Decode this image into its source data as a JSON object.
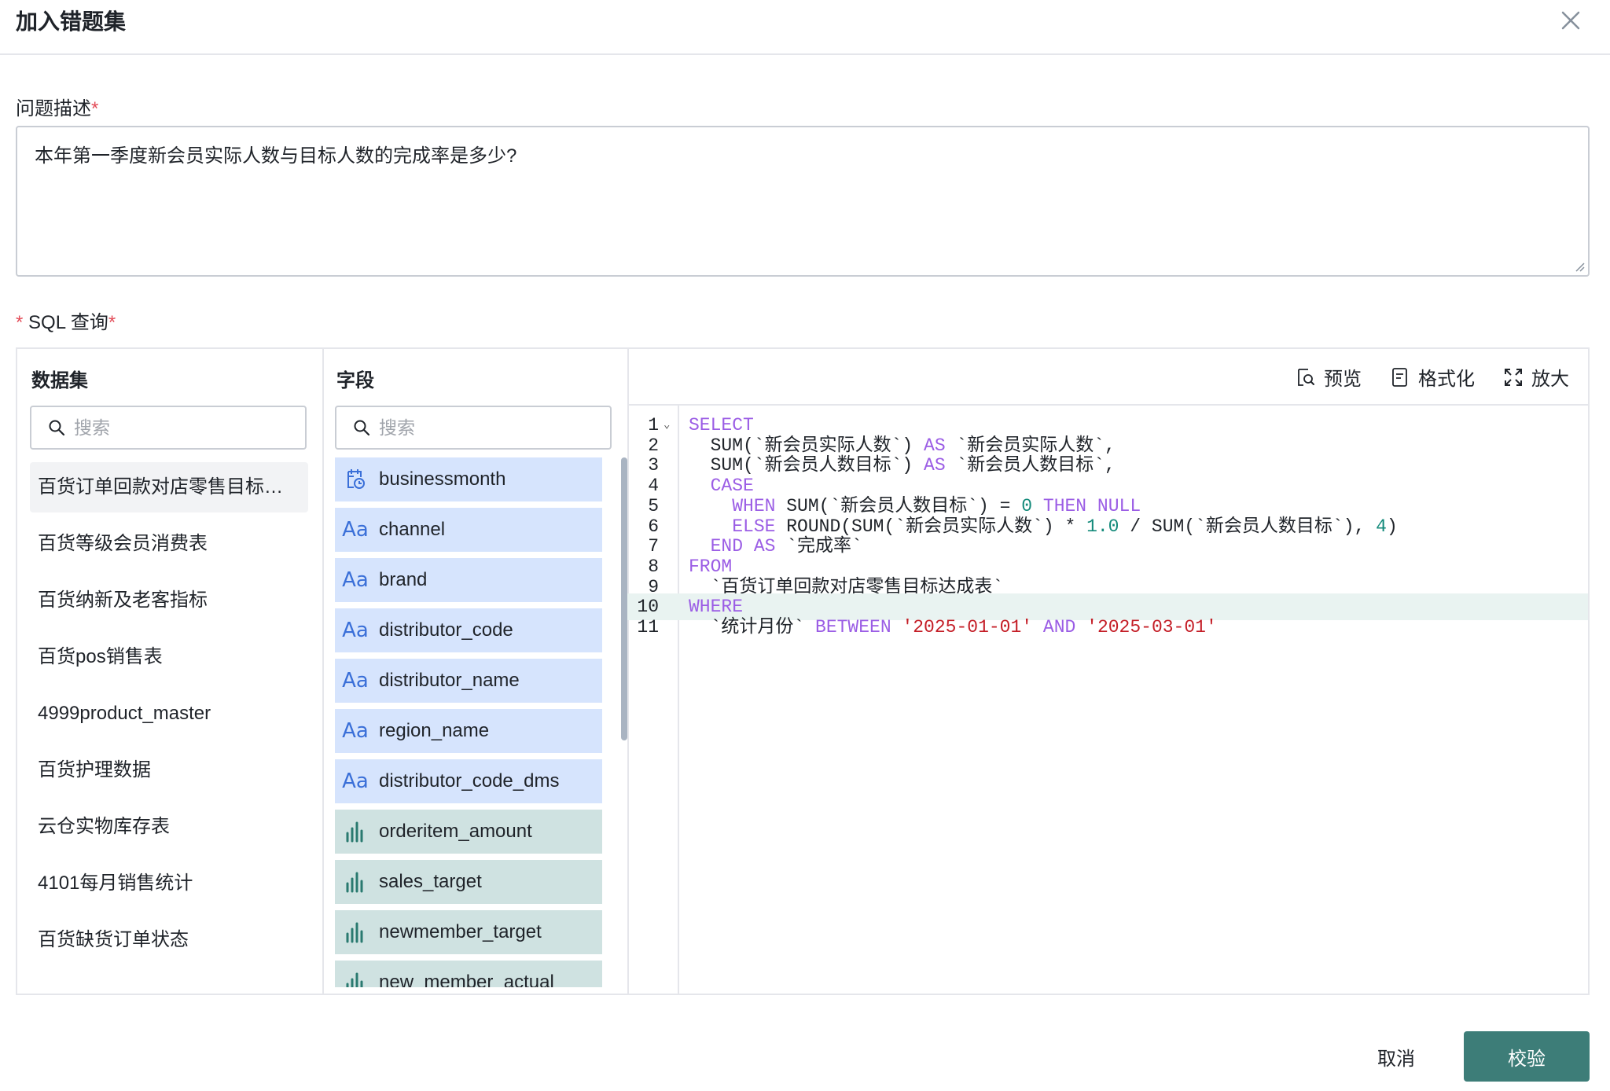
{
  "dialog": {
    "title": "加入错题集"
  },
  "description": {
    "label": "问题描述",
    "required_mark": "*",
    "value": "本年第一季度新会员实际人数与目标人数的完成率是多少?"
  },
  "sql": {
    "label_prefix_mark": "*",
    "label": "SQL 查询",
    "required_mark": "*"
  },
  "datasets": {
    "title": "数据集",
    "search_placeholder": "搜索",
    "items": [
      "百货订单回款对店零售目标达成表",
      "百货等级会员消费表",
      "百货纳新及老客指标",
      "百货pos销售表",
      "4999product_master",
      "百货护理数据",
      "云仓实物库存表",
      "4101每月销售统计",
      "百货缺货订单状态"
    ]
  },
  "fields": {
    "title": "字段",
    "search_placeholder": "搜索",
    "items": [
      {
        "name": "businessmonth",
        "type": "date"
      },
      {
        "name": "channel",
        "type": "text",
        "icon": "Aa"
      },
      {
        "name": "brand",
        "type": "text",
        "icon": "Aa"
      },
      {
        "name": "distributor_code",
        "type": "text",
        "icon": "Aa"
      },
      {
        "name": "distributor_name",
        "type": "text",
        "icon": "Aa"
      },
      {
        "name": "region_name",
        "type": "text",
        "icon": "Aa"
      },
      {
        "name": "distributor_code_dms",
        "type": "text",
        "icon": "Aa"
      },
      {
        "name": "orderitem_amount",
        "type": "measure"
      },
      {
        "name": "sales_target",
        "type": "measure"
      },
      {
        "name": "newmember_target",
        "type": "measure"
      },
      {
        "name": "new_member_actual",
        "type": "measure"
      }
    ]
  },
  "toolbar": {
    "preview": "预览",
    "format": "格式化",
    "expand": "放大"
  },
  "editor": {
    "active_line": 10,
    "lines": [
      {
        "n": "1",
        "fold": true,
        "tokens": [
          [
            "kw",
            "SELECT"
          ]
        ]
      },
      {
        "n": "2",
        "tokens": [
          [
            "",
            "  SUM(`新会员实际人数`) "
          ],
          [
            "kw",
            "AS"
          ],
          [
            "",
            " `新会员实际人数`,"
          ]
        ]
      },
      {
        "n": "3",
        "tokens": [
          [
            "",
            "  SUM(`新会员人数目标`) "
          ],
          [
            "kw",
            "AS"
          ],
          [
            "",
            " `新会员人数目标`,"
          ]
        ]
      },
      {
        "n": "4",
        "tokens": [
          [
            "",
            "  "
          ],
          [
            "kw",
            "CASE"
          ]
        ]
      },
      {
        "n": "5",
        "tokens": [
          [
            "",
            "    "
          ],
          [
            "kw",
            "WHEN"
          ],
          [
            "",
            " SUM(`新会员人数目标`) = "
          ],
          [
            "num",
            "0"
          ],
          [
            "",
            " "
          ],
          [
            "kw",
            "THEN"
          ],
          [
            "",
            " "
          ],
          [
            "kw",
            "NULL"
          ]
        ]
      },
      {
        "n": "6",
        "tokens": [
          [
            "",
            "    "
          ],
          [
            "kw",
            "ELSE"
          ],
          [
            "",
            " ROUND(SUM(`新会员实际人数`) * "
          ],
          [
            "num",
            "1.0"
          ],
          [
            "",
            " / SUM(`新会员人数目标`), "
          ],
          [
            "num",
            "4"
          ],
          [
            "",
            ")"
          ]
        ]
      },
      {
        "n": "7",
        "tokens": [
          [
            "",
            "  "
          ],
          [
            "kw",
            "END"
          ],
          [
            "",
            " "
          ],
          [
            "kw",
            "AS"
          ],
          [
            "",
            " `完成率`"
          ]
        ]
      },
      {
        "n": "8",
        "tokens": [
          [
            "kw",
            "FROM"
          ]
        ]
      },
      {
        "n": "9",
        "tokens": [
          [
            "",
            "  `百货订单回款对店零售目标达成表`"
          ]
        ]
      },
      {
        "n": "10",
        "tokens": [
          [
            "kw",
            "WHERE"
          ]
        ]
      },
      {
        "n": "11",
        "tokens": [
          [
            "",
            "  `统计月份` "
          ],
          [
            "kw",
            "BETWEEN"
          ],
          [
            "",
            " "
          ],
          [
            "str",
            "'2025-01-01'"
          ],
          [
            "",
            " "
          ],
          [
            "kw",
            "AND"
          ],
          [
            "",
            " "
          ],
          [
            "str",
            "'2025-03-01'"
          ]
        ]
      }
    ]
  },
  "footer": {
    "cancel": "取消",
    "verify": "校验"
  },
  "colors": {
    "primary": "#3d7d78",
    "dimension_field_bg": "#d6e4fd",
    "measure_field_bg": "#cfe2e1",
    "keyword": "#9b5de5",
    "number": "#138a7a",
    "string": "#c41d26",
    "required": "#e34d59"
  }
}
